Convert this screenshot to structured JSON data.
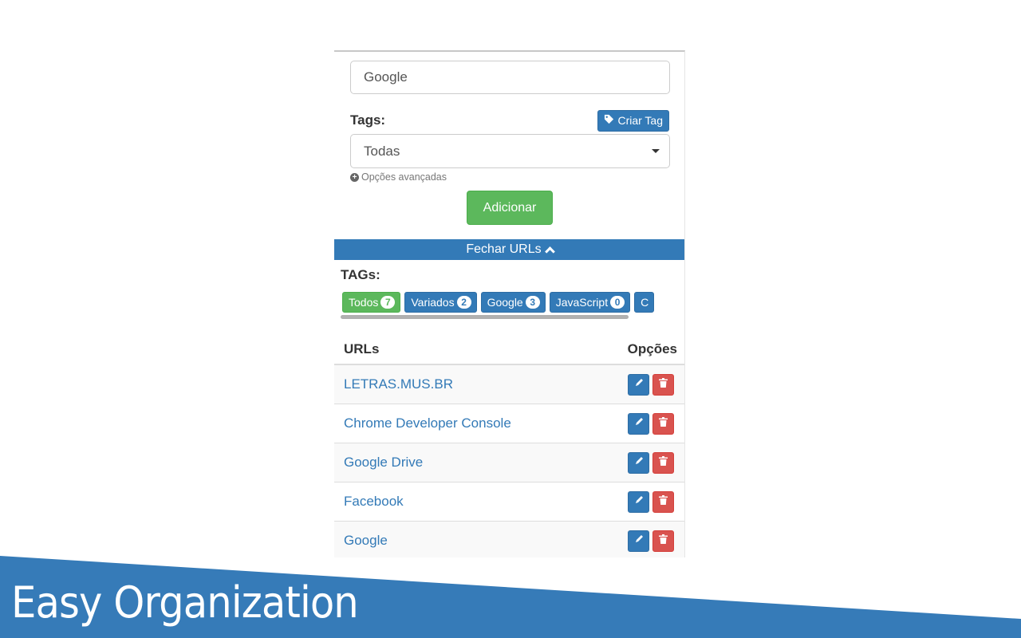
{
  "form": {
    "url_name_value": "Google",
    "tags_label": "Tags:",
    "create_tag_label": "Criar Tag",
    "tag_select_value": "Todas",
    "advanced_options_label": "Opções avançadas",
    "add_button_label": "Adicionar"
  },
  "toggle": {
    "label": "Fechar URLs"
  },
  "tags_section": {
    "title": "TAGs:",
    "tags": [
      {
        "label": "Todos",
        "count": "7",
        "active": true
      },
      {
        "label": "Variados",
        "count": "2",
        "active": false
      },
      {
        "label": "Google",
        "count": "3",
        "active": false
      },
      {
        "label": "JavaScript",
        "count": "0",
        "active": false
      },
      {
        "label": "C",
        "count": "",
        "active": false
      }
    ]
  },
  "url_table": {
    "header_urls": "URLs",
    "header_options": "Opções",
    "rows": [
      {
        "name": "LETRAS.MUS.BR"
      },
      {
        "name": "Chrome Developer Console"
      },
      {
        "name": "Google Drive"
      },
      {
        "name": "Facebook"
      },
      {
        "name": "Google"
      }
    ]
  },
  "banner": {
    "title": "Easy Organization",
    "color": "#367bb8"
  },
  "colors": {
    "primary": "#337ab7",
    "success": "#5cb85c",
    "danger": "#d9534f"
  }
}
